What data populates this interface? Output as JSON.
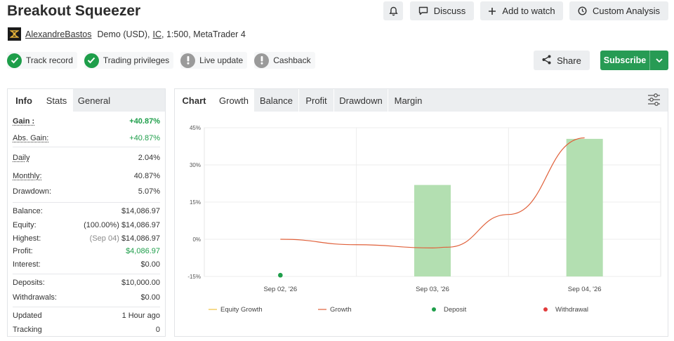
{
  "header": {
    "title": "Breakout Squeezer",
    "buttons": {
      "discuss": "Discuss",
      "watch": "Add to watch",
      "analysis": "Custom Analysis"
    }
  },
  "account": {
    "author": "AlexandreBastos",
    "type": "Demo (USD),",
    "broker": "IC",
    "rest": ", 1:500, MetaTrader 4"
  },
  "badges": [
    "Track record",
    "Trading privileges",
    "Live update",
    "Cashback"
  ],
  "actions": {
    "share": "Share",
    "subscribe": "Subscribe"
  },
  "left_tabs": [
    "Info",
    "Stats",
    "General"
  ],
  "stats": {
    "gain_label": "Gain :",
    "gain": "+40.87%",
    "abs_gain_label": "Abs. Gain:",
    "abs_gain": "+40.87%",
    "daily_label": "Daily",
    "daily": "2.04%",
    "monthly_label": "Monthly:",
    "monthly": "40.87%",
    "drawdown_label": "Drawdown:",
    "drawdown": "5.07%",
    "balance_label": "Balance:",
    "balance": "$14,086.97",
    "equity_label": "Equity:",
    "equity_pct": "(100.00%)",
    "equity": "$14,086.97",
    "highest_label": "Highest:",
    "highest_date": "(Sep 04)",
    "highest": "$14,086.97",
    "profit_label": "Profit:",
    "profit": "$4,086.97",
    "interest_label": "Interest:",
    "interest": "$0.00",
    "deposits_label": "Deposits:",
    "deposits": "$10,000.00",
    "withdrawals_label": "Withdrawals:",
    "withdrawals": "$0.00",
    "updated_label": "Updated",
    "updated": "1 Hour ago",
    "tracking_label": "Tracking",
    "tracking": "0"
  },
  "chart_tabs": [
    "Chart",
    "Growth",
    "Balance",
    "Profit",
    "Drawdown",
    "Margin"
  ],
  "colors": {
    "green": "#1e9e4a",
    "bar": "#b3dfb1",
    "growth_line": "#e0603a",
    "equity_line": "#f0c040",
    "withdrawal": "#e23b3b"
  },
  "chart_data": {
    "type": "bar",
    "categories": [
      "Sep 02, '26",
      "Sep 03, '26",
      "Sep 04, '26"
    ],
    "ylim": [
      -15,
      45
    ],
    "yticks": [
      -15,
      0,
      15,
      30,
      45
    ],
    "ytick_labels": [
      "-15%",
      "0%",
      "15%",
      "30%",
      "45%"
    ],
    "bar_values": [
      null,
      21.9,
      40.5
    ],
    "growth_line": [
      [
        0,
        0
      ],
      [
        0.5,
        -2.2
      ],
      [
        1.0,
        -3.5
      ],
      [
        1.1,
        -3.2
      ],
      [
        1.5,
        10
      ],
      [
        2.0,
        40.9
      ]
    ],
    "deposit_points": [
      [
        0,
        -14.5
      ]
    ],
    "legend": [
      "Equity Growth",
      "Growth",
      "Deposit",
      "Withdrawal"
    ],
    "grid": true
  }
}
